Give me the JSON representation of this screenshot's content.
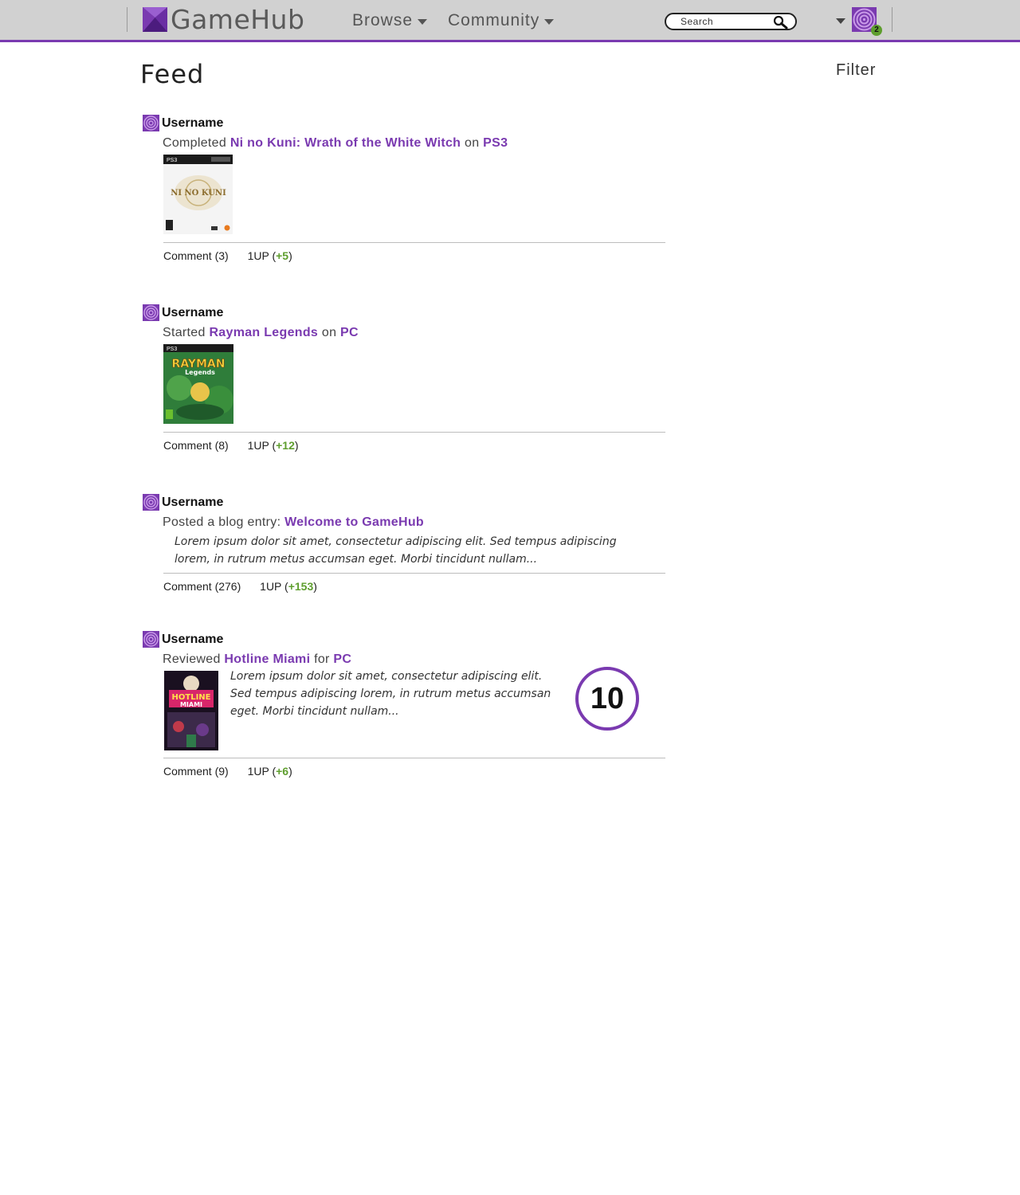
{
  "app": {
    "logo_text": "GameHub",
    "accent_color": "#7a3ab0",
    "positive_color": "#5e9e2e"
  },
  "nav": {
    "browse": "Browse",
    "community": "Community",
    "search_placeholder": "Search",
    "notification_count": "2"
  },
  "page": {
    "title": "Feed",
    "filter": "Filter"
  },
  "feed": [
    {
      "username": "Username",
      "verb": "Completed",
      "target": "Ni no Kuni: Wrath of the White Witch",
      "connector": "on",
      "platform": "PS3",
      "cover_label": "NI NO KUNI",
      "comment_label": "Comment (3)",
      "oneup_prefix": "1UP (",
      "oneup_value": "+5",
      "oneup_suffix": ")"
    },
    {
      "username": "Username",
      "verb": "Started",
      "target": "Rayman Legends",
      "connector": "on",
      "platform": "PC",
      "cover_label": "RAYMAN",
      "cover_sublabel": "Legends",
      "comment_label": "Comment (8)",
      "oneup_prefix": "1UP (",
      "oneup_value": "+12",
      "oneup_suffix": ")"
    },
    {
      "username": "Username",
      "verb": "Posted a blog entry:",
      "target": "Welcome to GameHub",
      "excerpt_line1": "Lorem ipsum dolor sit amet, consectetur adipiscing elit. Sed tempus adipiscing",
      "excerpt_line2": "lorem, in rutrum metus accumsan eget. Morbi tincidunt nullam...",
      "comment_label": "Comment (276)",
      "oneup_prefix": "1UP (",
      "oneup_value": "+153",
      "oneup_suffix": ")"
    },
    {
      "username": "Username",
      "verb": "Reviewed",
      "target": "Hotline Miami",
      "connector": "for",
      "platform": "PC",
      "cover_label": "HOTLINE",
      "cover_sublabel": "MIAMI",
      "excerpt_line1": "Lorem ipsum dolor sit amet, consectetur adipiscing elit.",
      "excerpt_line2": "Sed tempus adipiscing lorem, in rutrum metus accumsan",
      "excerpt_line3": "eget. Morbi tincidunt nullam...",
      "score": "10",
      "comment_label": "Comment (9)",
      "oneup_prefix": "1UP (",
      "oneup_value": "+6",
      "oneup_suffix": ")"
    }
  ]
}
